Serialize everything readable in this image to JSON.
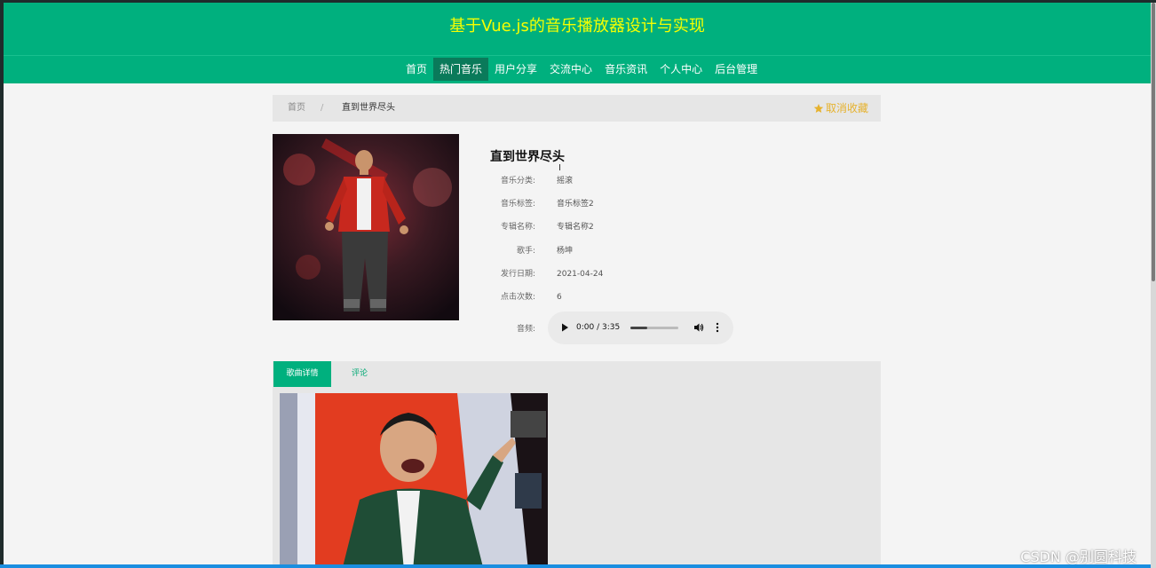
{
  "header": {
    "site_title": "基于Vue.js的音乐播放器设计与实现"
  },
  "nav": {
    "items": [
      {
        "label": "首页",
        "active": false
      },
      {
        "label": "热门音乐",
        "active": true
      },
      {
        "label": "用户分享",
        "active": false
      },
      {
        "label": "交流中心",
        "active": false
      },
      {
        "label": "音乐资讯",
        "active": false
      },
      {
        "label": "个人中心",
        "active": false
      },
      {
        "label": "后台管理",
        "active": false
      }
    ]
  },
  "breadcrumb": {
    "home": "首页",
    "separator": "/",
    "current": "直到世界尽头",
    "favorite_label": "取消收藏",
    "favorite_icon": "star-icon"
  },
  "song": {
    "title": "直到世界尽头",
    "fields": [
      {
        "label": "音乐分类:",
        "value": "摇滚"
      },
      {
        "label": "音乐标签:",
        "value": "音乐标签2"
      },
      {
        "label": "专辑名称:",
        "value": "专辑名称2"
      },
      {
        "label": "歌手:",
        "value": "杨坤"
      },
      {
        "label": "发行日期:",
        "value": "2021-04-24"
      },
      {
        "label": "点击次数:",
        "value": "6"
      }
    ],
    "audio_label": "音频:"
  },
  "player": {
    "time": "0:00 / 3:35",
    "progress": 0.35
  },
  "tabs": [
    {
      "label": "歌曲详情",
      "active": true
    },
    {
      "label": "评论",
      "active": false
    }
  ],
  "watermark": "CSDN @别圆科技",
  "colors": {
    "brand": "#00b07e",
    "title_yellow": "#f6ff00",
    "favorite": "#e6b22e"
  }
}
